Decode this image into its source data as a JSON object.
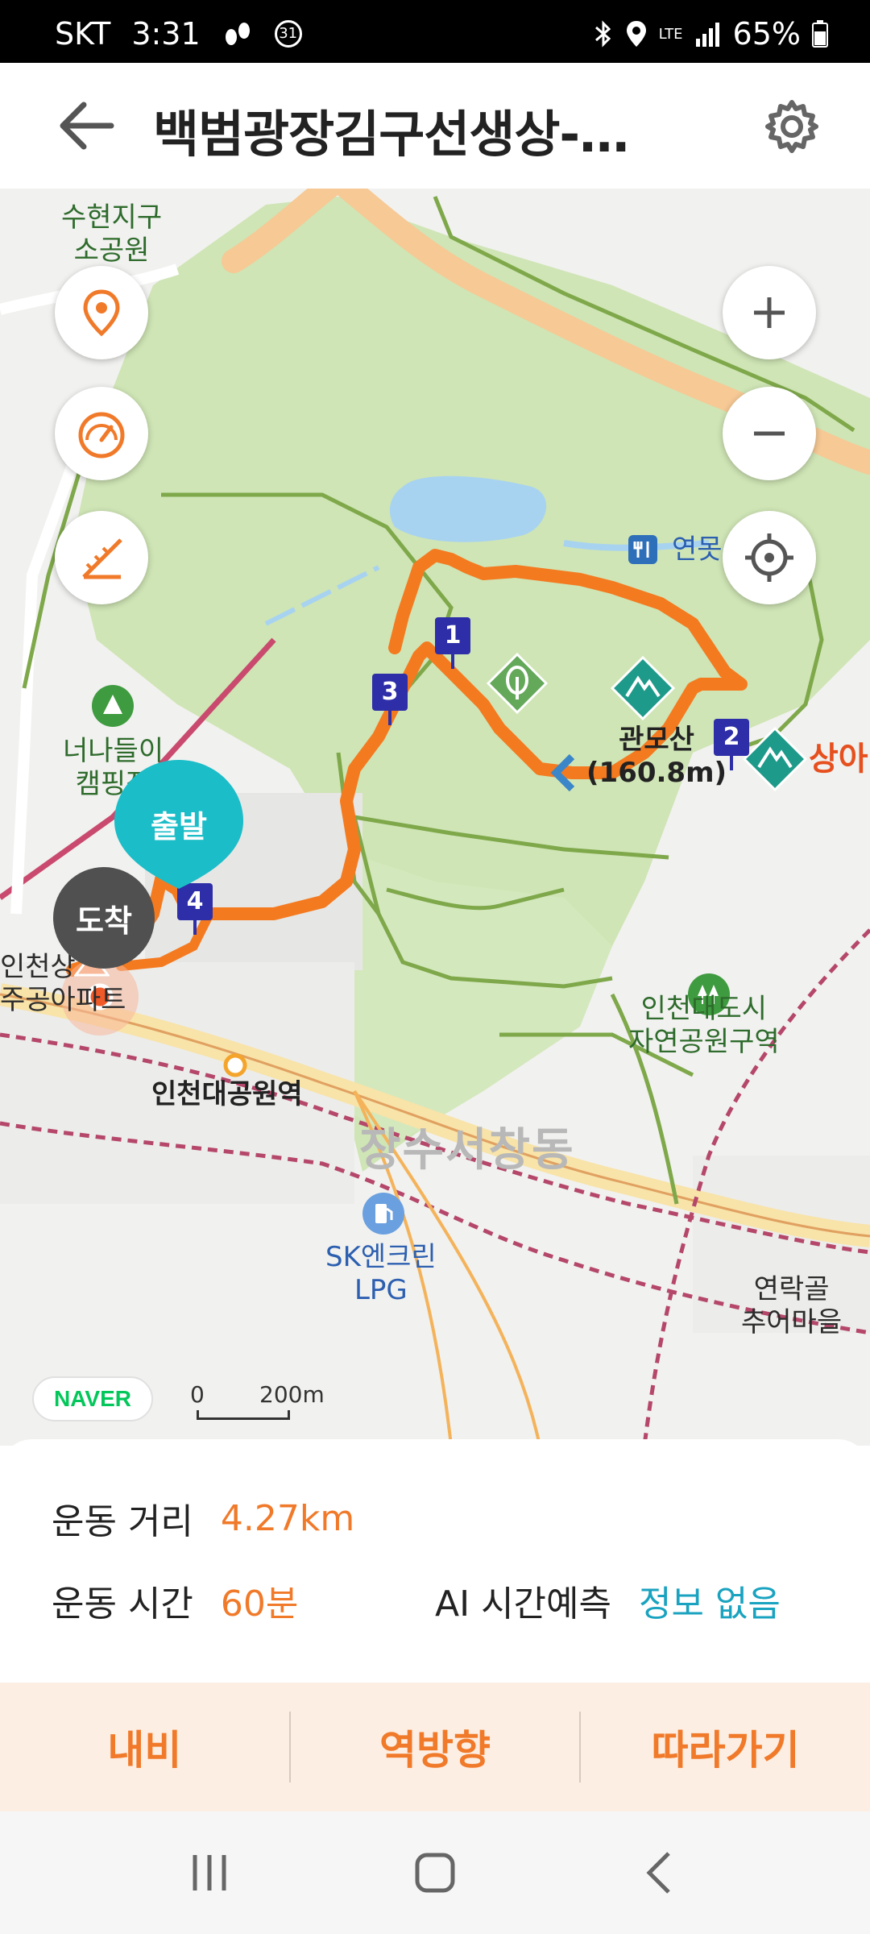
{
  "status_bar": {
    "carrier": "SKT",
    "time": "3:31",
    "notification_count": "31",
    "network": "LTE",
    "battery": "65%"
  },
  "header": {
    "title": "백범광장김구선생상-…"
  },
  "map": {
    "labels": {
      "suhyeon": "수현지구\n소공원",
      "yeonmot": "연못",
      "nanadeuri": "너나들이\n캠핑장",
      "gwanmosan": "관모산\n(160.8m)",
      "sangabu": "상아",
      "incheon_apt": "인천상\n주공아파트",
      "station": "인천대공원역",
      "nature_park": "인천대도시\n자연공원구역",
      "district": "장수서창동",
      "gas_station": "SK엔크린\nLPG",
      "yeonrakgol": "연락골\n추어마을"
    },
    "waypoints": [
      "1",
      "2",
      "3",
      "4"
    ],
    "start_marker": "출발",
    "end_marker": "도착",
    "logo": "NAVER",
    "scale": {
      "zero": "0",
      "distance": "200m"
    }
  },
  "info": {
    "distance_label": "운동 거리",
    "distance_value": "4.27km",
    "time_label": "운동 시간",
    "time_value": "60분",
    "ai_label": "AI 시간예측",
    "ai_value": "정보 없음"
  },
  "actions": {
    "navi": "내비",
    "reverse": "역방향",
    "follow": "따라가기"
  },
  "colors": {
    "accent": "#f07a2a",
    "route": "#f47a20",
    "park": "#cfe5b5",
    "start_marker": "#1bbdc8",
    "end_marker": "#505050",
    "waypoint": "#2d2ea8",
    "teal_value": "#1aa3c0"
  }
}
